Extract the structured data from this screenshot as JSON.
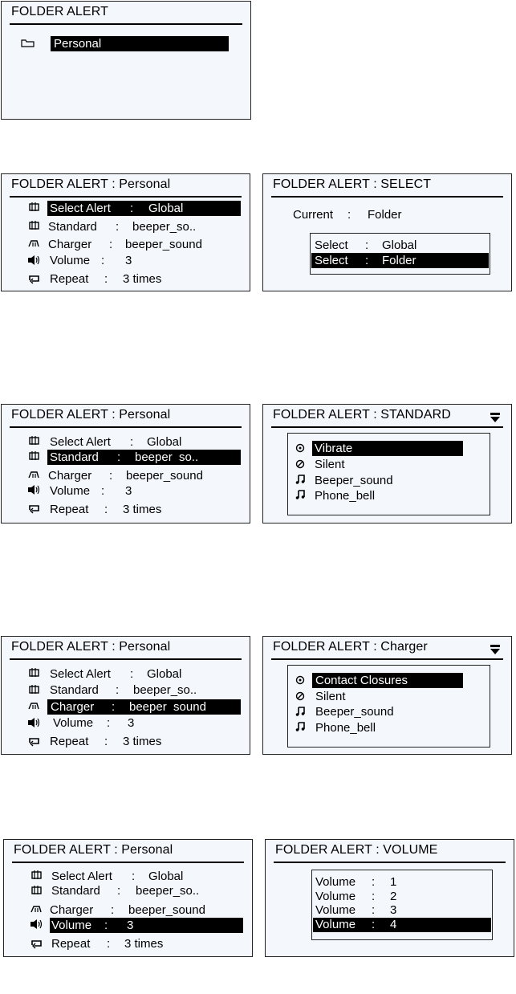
{
  "screen1": {
    "title": "FOLDER ALERT",
    "folder": "Personal"
  },
  "menu_rows": {
    "select_alert": {
      "label": "Select Alert",
      "sep": ":",
      "value": "Global"
    },
    "standard": {
      "label": "Standard",
      "sep": ":",
      "value": "beeper_so.."
    },
    "standard_hl": {
      "label": "Standard",
      "sep": ":",
      "value": "beeper  so.."
    },
    "charger": {
      "label": "Charger",
      "sep": ":",
      "value": "beeper_sound"
    },
    "charger_hl": {
      "label": "Charger",
      "sep": ":",
      "value": "beeper  sound"
    },
    "volume": {
      "label": "Volume",
      "sep": ":",
      "value": "3"
    },
    "repeat": {
      "label": "Repeat",
      "sep": ":",
      "value": "3 times"
    }
  },
  "personal_title": "FOLDER ALERT : Personal",
  "select_screen": {
    "title": "FOLDER ALERT : SELECT",
    "current_label": "Current",
    "sep": ":",
    "current_value": "Folder",
    "options": [
      {
        "label": "Select",
        "sep": ":",
        "value": "Global"
      },
      {
        "label": "Select",
        "sep": ":",
        "value": "Folder"
      }
    ]
  },
  "standard_screen": {
    "title": "FOLDER ALERT : STANDARD",
    "options": [
      "Vibrate",
      "Silent",
      "Beeper_sound",
      "Phone_bell"
    ]
  },
  "charger_screen": {
    "title": "FOLDER ALERT : Charger",
    "options": [
      "Contact Closures",
      "Silent",
      "Beeper_sound",
      "Phone_bell"
    ]
  },
  "volume_screen": {
    "title": "FOLDER ALERT : VOLUME",
    "options": [
      {
        "label": "Volume",
        "sep": ":",
        "value": "1"
      },
      {
        "label": "Volume",
        "sep": ":",
        "value": "2"
      },
      {
        "label": "Volume",
        "sep": ":",
        "value": "3"
      },
      {
        "label": "Volume",
        "sep": ":",
        "value": "4"
      }
    ]
  }
}
